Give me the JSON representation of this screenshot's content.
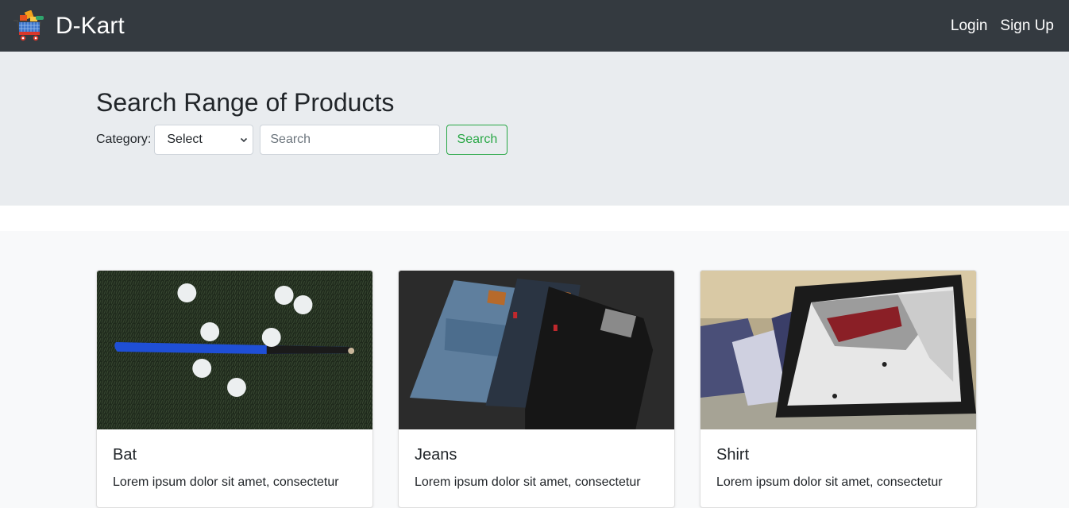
{
  "navbar": {
    "brand": "D-Kart",
    "logo_icon": "shopping-cart-logo-icon",
    "links": [
      "Login",
      "Sign Up"
    ]
  },
  "jumbotron": {
    "title": "Search Range of Products",
    "category_label": "Category:",
    "category_selected": "Select",
    "search_placeholder": "Search",
    "search_button": "Search"
  },
  "products": [
    {
      "name": "Bat",
      "text": "Lorem ipsum dolor sit amet, consectetur",
      "image_icon": "baseball-bat-photo"
    },
    {
      "name": "Jeans",
      "text": "Lorem ipsum dolor sit amet, consectetur",
      "image_icon": "jeans-photo"
    },
    {
      "name": "Shirt",
      "text": "Lorem ipsum dolor sit amet, consectetur",
      "image_icon": "shirt-photo"
    }
  ],
  "colors": {
    "navbar_bg": "#343a40",
    "jumbotron_bg": "#e9ecef",
    "success": "#28a745",
    "page_bg": "#f8f9fa"
  }
}
